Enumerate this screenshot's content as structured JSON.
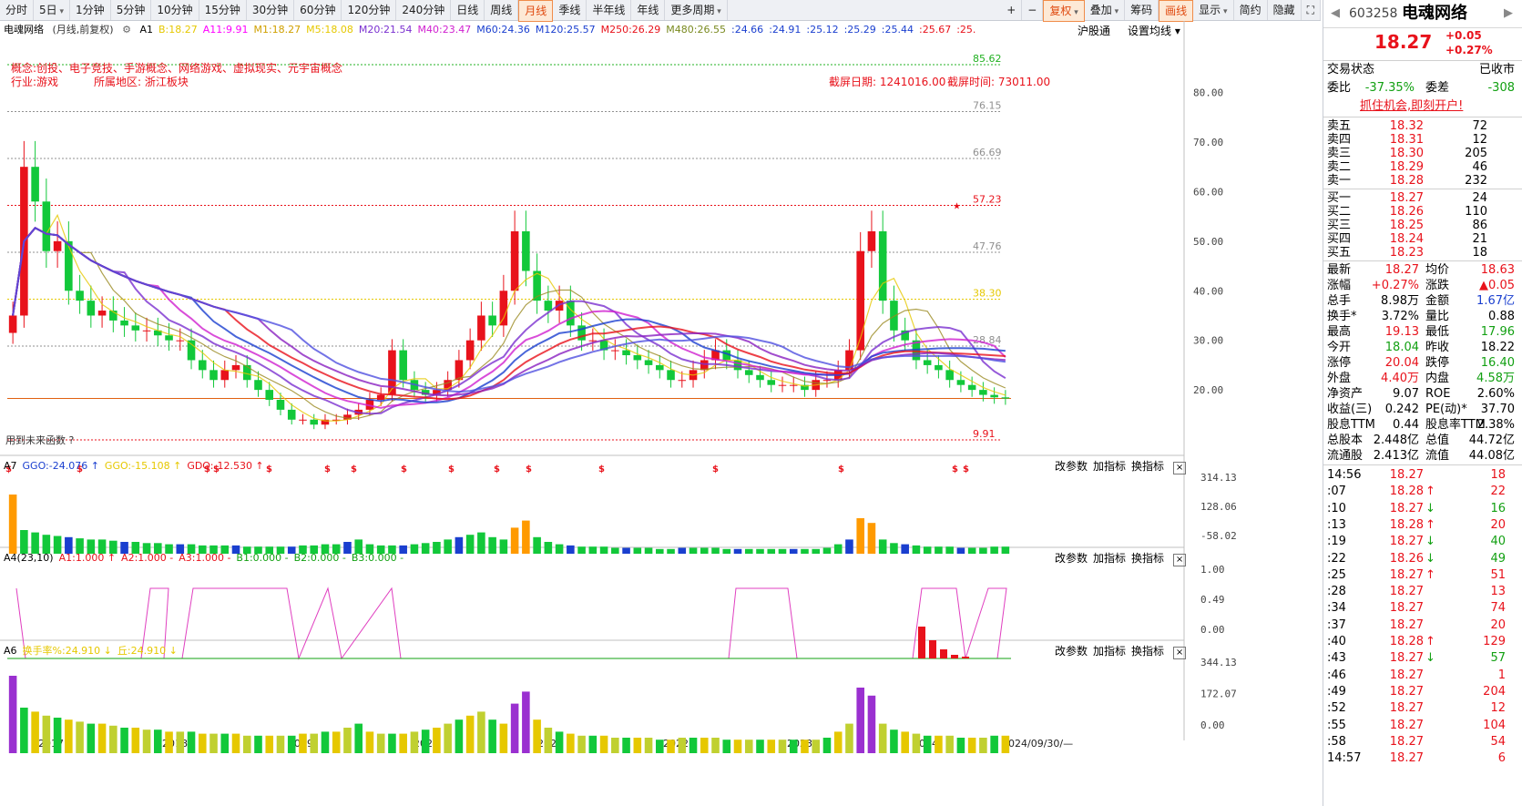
{
  "toolbar": {
    "periods": [
      "分时",
      "5日",
      "1分钟",
      "5分钟",
      "10分钟",
      "15分钟",
      "30分钟",
      "60分钟",
      "120分钟",
      "240分钟",
      "日线",
      "周线",
      "月线",
      "季线",
      "半年线",
      "年线",
      "更多周期"
    ],
    "selected": "月线",
    "right_buttons": [
      "+",
      "−",
      "复权",
      "叠加",
      "筹码",
      "画线",
      "显示",
      "简约",
      "隐藏"
    ],
    "expand_icon": "expand-icon"
  },
  "chart_header": {
    "stock": "电魂网络",
    "mode": "(月线,前复权)",
    "gear_icon": "gear-icon",
    "ma_legend": [
      {
        "t": "A1",
        "c": "#000"
      },
      {
        "t": "B:18.27",
        "c": "#e6c800"
      },
      {
        "t": "A11:9.91",
        "c": "#ff00ff"
      },
      {
        "t": "M1:18.27",
        "c": "#d0a000"
      },
      {
        "t": "M5:18.08",
        "c": "#e6c800"
      },
      {
        "t": "M20:21.54",
        "c": "#7a30d0"
      },
      {
        "t": "M40:23.47",
        "c": "#d020d0"
      },
      {
        "t": "M60:24.36",
        "c": "#1a3fcf"
      },
      {
        "t": "M120:25.57",
        "c": "#1a3fcf"
      },
      {
        "t": "M250:26.29",
        "c": "#e8121b"
      },
      {
        "t": "M480:26.55",
        "c": "#7a8a20"
      },
      {
        "t": ":24.66",
        "c": "#1a3fcf"
      },
      {
        "t": ":24.91",
        "c": "#1a3fcf"
      },
      {
        "t": ":25.12",
        "c": "#1a3fcf"
      },
      {
        "t": ":25.29",
        "c": "#1a3fcf"
      },
      {
        "t": ":25.44",
        "c": "#1a3fcf"
      },
      {
        "t": ":25.67",
        "c": "#e8121b"
      },
      {
        "t": ":25.",
        "c": "#e8121b"
      }
    ],
    "hu_shen": "沪股通",
    "set_ma": "设置均线"
  },
  "info": {
    "concept": "概念:创投、电子竞技、手游概念、网络游戏、虚拟现实、元宇宙概念",
    "industry": "行业:游戏",
    "region": "所属地区: 浙江板块",
    "shot_date": "截屏日期: 1241016.00",
    "shot_time": "截屏时间: 73011.00",
    "future_fn": "用到未来函数 ?"
  },
  "chart_data": [
    {
      "type": "candlestick",
      "period": "monthly",
      "y_ticks": [
        20,
        30,
        40,
        50,
        60,
        70,
        80
      ],
      "ylim": [
        9,
        88
      ],
      "level_lines": [
        {
          "label": "85.62",
          "value": 85.62,
          "color": "#20b020"
        },
        {
          "label": "76.15",
          "value": 76.15,
          "color": "#909090"
        },
        {
          "label": "66.69",
          "value": 66.69,
          "color": "#909090"
        },
        {
          "label": "57.23",
          "value": 57.23,
          "color": "#e8121b"
        },
        {
          "label": "47.76",
          "value": 47.76,
          "color": "#909090"
        },
        {
          "label": "38.30",
          "value": 38.3,
          "color": "#e6c800"
        },
        {
          "label": "28.84",
          "value": 28.84,
          "color": "#909090"
        },
        {
          "label": "9.91",
          "value": 9.91,
          "color": "#e8121b"
        }
      ],
      "x_labels": [
        "2017",
        "2018",
        "2019",
        "2020",
        "2021",
        "2022",
        "2023",
        "2024",
        "2024/09/30/—"
      ],
      "closes": [
        35,
        65,
        58,
        48,
        50,
        40,
        38,
        35,
        36,
        34,
        33,
        32,
        32,
        31,
        30,
        30,
        26,
        24,
        22,
        24,
        25,
        22,
        20,
        18,
        16,
        14,
        14,
        13,
        14,
        14,
        15,
        16,
        18,
        19,
        28,
        22,
        20,
        19,
        20,
        22,
        26,
        30,
        35,
        33,
        40,
        52,
        44,
        38,
        36,
        38,
        33,
        30,
        30,
        28,
        28,
        27,
        26,
        25,
        24,
        22,
        22,
        24,
        26,
        28,
        26,
        24,
        23,
        22,
        21,
        21,
        21,
        20,
        22,
        22,
        24,
        28,
        48,
        52,
        38,
        32,
        30,
        26,
        25,
        24,
        22,
        21,
        20,
        19,
        18.5,
        18.27
      ],
      "volumes": [
        50,
        20,
        18,
        16,
        15,
        14,
        13,
        12,
        12,
        11,
        10,
        10,
        9,
        9,
        8,
        8,
        8,
        7,
        7,
        7,
        7,
        6,
        6,
        6,
        6,
        6,
        7,
        7,
        8,
        8,
        10,
        12,
        8,
        7,
        7,
        7,
        8,
        9,
        10,
        12,
        14,
        16,
        18,
        14,
        12,
        22,
        28,
        14,
        10,
        8,
        7,
        6,
        6,
        6,
        5,
        5,
        5,
        5,
        4,
        4,
        5,
        5,
        5,
        5,
        4,
        4,
        4,
        4,
        4,
        4,
        4,
        4,
        4,
        5,
        8,
        12,
        30,
        26,
        12,
        9,
        8,
        7,
        6,
        6,
        6,
        5,
        5,
        5,
        6,
        6
      ],
      "high": 85.62,
      "low": 9.91
    },
    {
      "type": "bar",
      "panel": "A7",
      "legend": [
        {
          "t": "GGO:-24.076 ↑",
          "c": "#1a3fcf"
        },
        {
          "t": "GGO:-15.108 ↑",
          "c": "#e6c800"
        },
        {
          "t": "GDO:-12.530 ↑",
          "c": "#e8121b"
        }
      ],
      "y_ticks": [
        "314.13",
        "128.06",
        "-58.02"
      ]
    },
    {
      "type": "line",
      "panel": "A4(23,10)",
      "legend": [
        {
          "t": "A1:1.000 ↑",
          "c": "#e8121b"
        },
        {
          "t": "A2:1.000 -",
          "c": "#e8121b"
        },
        {
          "t": "A3:1.000 -",
          "c": "#e8121b"
        },
        {
          "t": "B1:0.000 -",
          "c": "#12a012"
        },
        {
          "t": "B2:0.000 -",
          "c": "#12a012"
        },
        {
          "t": "B3:0.000 -",
          "c": "#12a012"
        }
      ],
      "y_ticks": [
        "1.00",
        "0.49",
        "0.00"
      ]
    },
    {
      "type": "bar",
      "panel": "A6",
      "legend": [
        {
          "t": "换手率%:24.910 ↓",
          "c": "#e6c800"
        },
        {
          "t": "丘:24.910 ↓",
          "c": "#e6c800"
        }
      ],
      "y_ticks": [
        "344.13",
        "172.07",
        "0.00"
      ]
    }
  ],
  "panel_tools": [
    "改参数",
    "加指标",
    "换指标"
  ],
  "close_icon": "close-icon",
  "quote": {
    "code": "603258",
    "name": "电魂网络",
    "price": "18.27",
    "change": "+0.05",
    "pct": "+0.27%",
    "status_label": "交易状态",
    "status": "已收市",
    "wb_label": "委比",
    "wb": "-37.35%",
    "wc_label": "委差",
    "wc": "-308",
    "promo": "抓住机会,即刻开户!",
    "asks": [
      [
        "卖五",
        "18.32",
        "72"
      ],
      [
        "卖四",
        "18.31",
        "12"
      ],
      [
        "卖三",
        "18.30",
        "205"
      ],
      [
        "卖二",
        "18.29",
        "46"
      ],
      [
        "卖一",
        "18.28",
        "232"
      ]
    ],
    "bids": [
      [
        "买一",
        "18.27",
        "24"
      ],
      [
        "买二",
        "18.26",
        "110"
      ],
      [
        "买三",
        "18.25",
        "86"
      ],
      [
        "买四",
        "18.24",
        "21"
      ],
      [
        "买五",
        "18.23",
        "18"
      ]
    ],
    "stats": [
      [
        "最新",
        "18.27",
        "red",
        "均价",
        "18.63",
        "red"
      ],
      [
        "涨幅",
        "+0.27%",
        "red",
        "涨跌",
        "▲0.05",
        "red"
      ],
      [
        "总手",
        "8.98万",
        "",
        "金额",
        "1.67亿",
        "blue"
      ],
      [
        "换手*",
        "3.72%",
        "",
        "量比",
        "0.88",
        ""
      ],
      [
        "最高",
        "19.13",
        "red",
        "最低",
        "17.96",
        "grn"
      ],
      [
        "今开",
        "18.04",
        "grn",
        "昨收",
        "18.22",
        ""
      ],
      [
        "涨停",
        "20.04",
        "red",
        "跌停",
        "16.40",
        "grn"
      ],
      [
        "外盘",
        "4.40万",
        "red",
        "内盘",
        "4.58万",
        "grn"
      ],
      [
        "净资产",
        "9.07",
        "",
        "ROE",
        "2.60%",
        ""
      ],
      [
        "收益(三)",
        "0.242",
        "",
        "PE(动)*",
        "37.70",
        ""
      ],
      [
        "股息TTM",
        "0.44",
        "",
        "股息率TTM",
        "2.38%",
        ""
      ],
      [
        "总股本",
        "2.448亿",
        "",
        "总值",
        "44.72亿",
        ""
      ],
      [
        "流通股",
        "2.413亿",
        "",
        "流值",
        "44.08亿",
        ""
      ]
    ],
    "ticks": [
      [
        "14:56",
        "18.27",
        "",
        "18"
      ],
      [
        ":07",
        "18.28",
        "up",
        "22"
      ],
      [
        ":10",
        "18.27",
        "down",
        "16"
      ],
      [
        ":13",
        "18.28",
        "up",
        "20"
      ],
      [
        ":19",
        "18.27",
        "down",
        "40"
      ],
      [
        ":22",
        "18.26",
        "down",
        "49"
      ],
      [
        ":25",
        "18.27",
        "up",
        "51"
      ],
      [
        ":28",
        "18.27",
        "",
        "13"
      ],
      [
        ":34",
        "18.27",
        "",
        "74"
      ],
      [
        ":37",
        "18.27",
        "",
        "20"
      ],
      [
        ":40",
        "18.28",
        "up",
        "129"
      ],
      [
        ":43",
        "18.27",
        "down",
        "57"
      ],
      [
        ":46",
        "18.27",
        "",
        "1"
      ],
      [
        ":49",
        "18.27",
        "",
        "204"
      ],
      [
        ":52",
        "18.27",
        "",
        "12"
      ],
      [
        ":55",
        "18.27",
        "",
        "104"
      ],
      [
        ":58",
        "18.27",
        "",
        "54"
      ],
      [
        "14:57",
        "18.27",
        "",
        "6"
      ]
    ]
  }
}
